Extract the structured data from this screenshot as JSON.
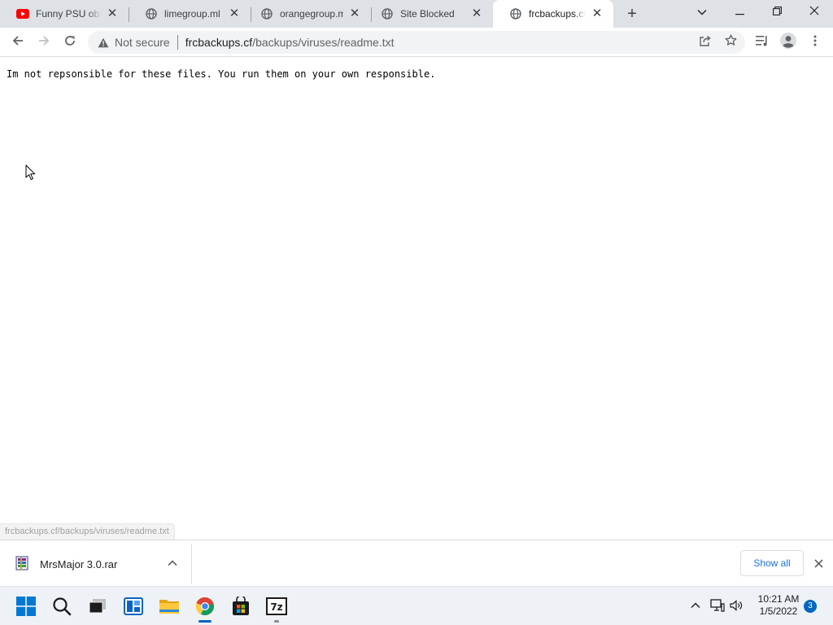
{
  "browser": {
    "tabs": [
      {
        "title": "Funny PSU obfu",
        "favicon": "youtube-icon",
        "active": false
      },
      {
        "title": "limegroup.ml",
        "favicon": "globe-icon",
        "active": false
      },
      {
        "title": "orangegroup.ml",
        "favicon": "globe-icon",
        "active": false
      },
      {
        "title": "Site Blocked",
        "favicon": "globe-icon",
        "active": false
      },
      {
        "title": "frcbackups.cf/b",
        "favicon": "globe-icon",
        "active": true
      }
    ],
    "close_glyph": "✕",
    "new_tab_glyph": "+",
    "omnibox": {
      "security_label": "Not secure",
      "url_host": "frcbackups.cf",
      "url_path": "/backups/viruses/readme.txt"
    }
  },
  "page": {
    "text": "Im not repsonsible for these files. You run them on your own responsible."
  },
  "status_bar": {
    "text": "frcbackups.cf/backups/viruses/readme.txt"
  },
  "download_shelf": {
    "items": [
      {
        "filename": "MrsMajor 3.0.rar",
        "icon": "winrar-archive-icon"
      }
    ],
    "show_all_label": "Show all"
  },
  "taskbar": {
    "apps": [
      "start-icon",
      "search-icon",
      "task-view-icon",
      "widgets-icon",
      "file-explorer-icon",
      "chrome-icon",
      "microsoft-store-icon",
      "7zip-icon"
    ],
    "clock": {
      "time": "10:21 AM",
      "date": "1/5/2022"
    },
    "notification_count": "3"
  },
  "colors": {
    "tab_strip": "#dee1e6",
    "accent_blue": "#1a73e8",
    "taskbar": "#eef2f7",
    "youtube_red": "#ff0000"
  }
}
